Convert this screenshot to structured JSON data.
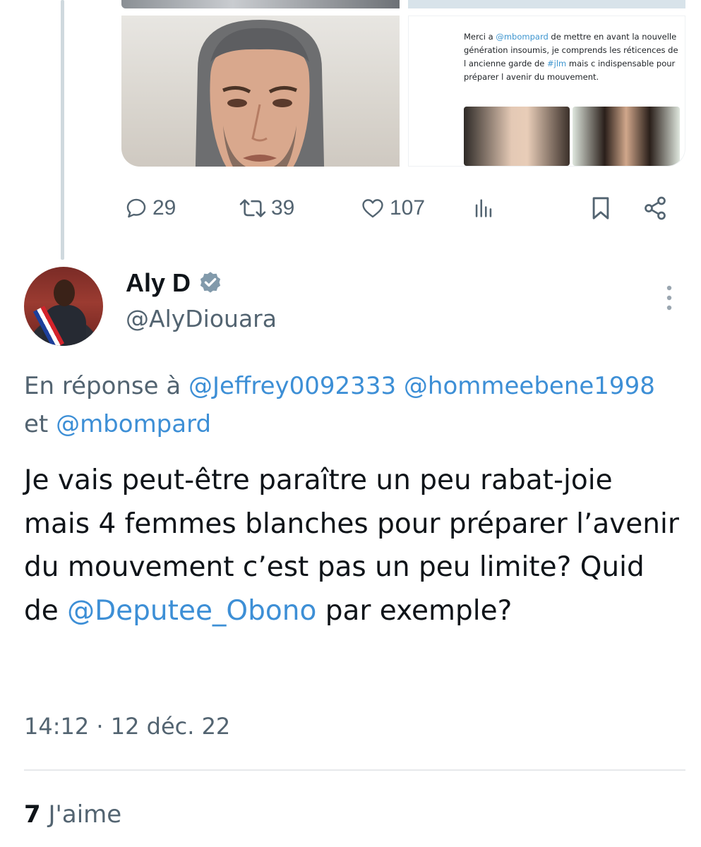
{
  "parent_tweet": {
    "media": {
      "screenshot_text": {
        "prefix": "Merci a ",
        "mention": "@mbompard",
        "middle": " de mettre en avant la nouvelle génération insoumis, je comprends les réticences de l ancienne garde de ",
        "hashtag": "#jlm",
        "suffix": " mais c indispensable pour préparer l avenir du mouvement."
      }
    },
    "actions": {
      "replies": "29",
      "retweets": "39",
      "likes": "107"
    }
  },
  "tweet": {
    "display_name": "Aly D",
    "verified": true,
    "handle": "@AlyDiouara",
    "reply_prefix": "En réponse à ",
    "reply_mentions": [
      "@Jeffrey0092333",
      "@hommeebene1998",
      "@mbompard"
    ],
    "reply_connector": " et ",
    "text_before_mention": "Je vais peut-être paraître un peu rabat-joie mais 4 femmes blanches pour préparer l’avenir du mouvement c’est pas un peu limite? Quid de ",
    "text_mention": "@Deputee_Obono",
    "text_after_mention": " par exemple?",
    "timestamp": "14:12 · 12 déc. 22",
    "likes_count": "7",
    "likes_label": " J'aime"
  },
  "colors": {
    "link": "#3d8fd6",
    "secondary_text": "#536471",
    "primary_text": "#0f1419",
    "thread_line": "#cfd9de"
  },
  "icons": [
    "reply-icon",
    "retweet-icon",
    "like-icon",
    "views-icon",
    "bookmark-icon",
    "share-icon",
    "verified-badge-icon",
    "more-options-icon"
  ]
}
